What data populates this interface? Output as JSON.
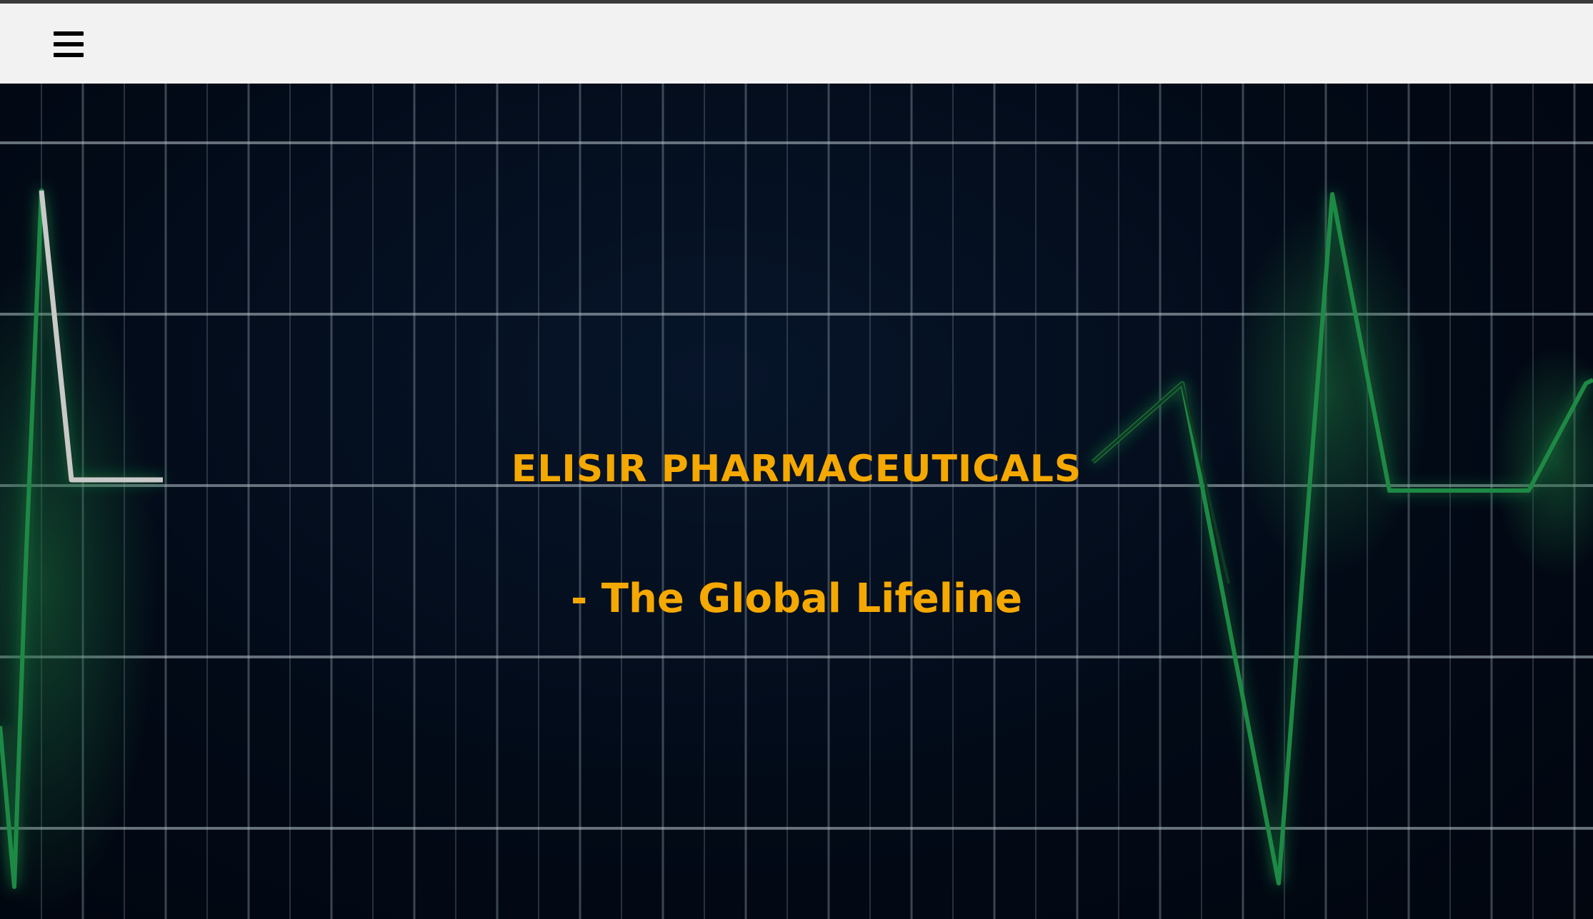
{
  "header": {
    "menu_icon": "hamburger-menu-icon"
  },
  "hero": {
    "title": "ELISIR PHARMACEUTICALS",
    "tagline": "- The Global Lifeline",
    "text_color": "#f5a800",
    "background_color": "#020a17",
    "trace_color": "#1e8a45"
  }
}
